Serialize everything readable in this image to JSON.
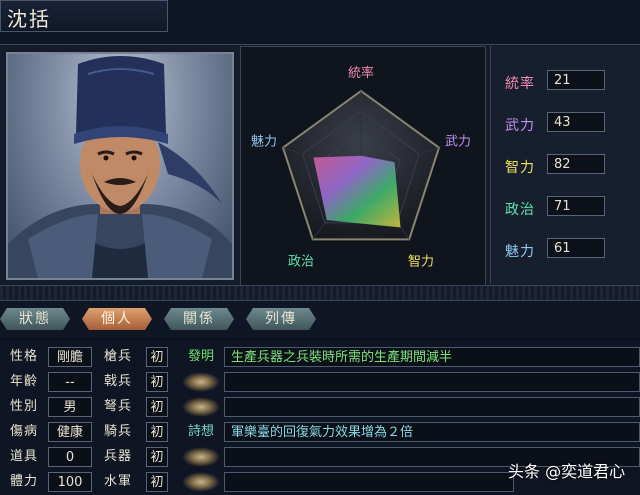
{
  "header": {
    "name": "沈括"
  },
  "colors": {
    "tong": "#f08ab0",
    "wu": "#c090f0",
    "zhi": "#f0e060",
    "zheng": "#60e0b0",
    "mei": "#90c8f0"
  },
  "radar": {
    "labels": {
      "tong": "統率",
      "wu": "武力",
      "zhi": "智力",
      "zheng": "政治",
      "mei": "魅力"
    },
    "max": 100
  },
  "stats": [
    {
      "key": "tong",
      "label": "統率",
      "value": "21"
    },
    {
      "key": "wu",
      "label": "武力",
      "value": "43"
    },
    {
      "key": "zhi",
      "label": "智力",
      "value": "82"
    },
    {
      "key": "zheng",
      "label": "政治",
      "value": "71"
    },
    {
      "key": "mei",
      "label": "魅力",
      "value": "61"
    }
  ],
  "tabs": [
    "狀態",
    "個人",
    "關係",
    "列傳"
  ],
  "personal": [
    {
      "label": "性格",
      "value": "剛膽"
    },
    {
      "label": "年齡",
      "value": "--"
    },
    {
      "label": "性別",
      "value": "男"
    },
    {
      "label": "傷病",
      "value": "健康"
    },
    {
      "label": "道具",
      "value": "0"
    },
    {
      "label": "體力",
      "value": "100"
    }
  ],
  "skills": [
    {
      "label": "槍兵",
      "rank": "初"
    },
    {
      "label": "戟兵",
      "rank": "初"
    },
    {
      "label": "弩兵",
      "rank": "初"
    },
    {
      "label": "騎兵",
      "rank": "初"
    },
    {
      "label": "兵器",
      "rank": "初"
    },
    {
      "label": "水軍",
      "rank": "初"
    }
  ],
  "traits": [
    {
      "tag": "發明",
      "desc": "生產兵器之兵裝時所需的生產期間減半",
      "style": "green"
    },
    {
      "tag": "",
      "desc": "",
      "style": "empty"
    },
    {
      "tag": "",
      "desc": "",
      "style": "empty"
    },
    {
      "tag": "詩想",
      "desc": "軍樂臺的回復氣力效果增為２倍",
      "style": "teal"
    },
    {
      "tag": "",
      "desc": "",
      "style": "empty"
    },
    {
      "tag": "",
      "desc": "",
      "style": "empty"
    }
  ],
  "watermark": "头条 @奕道君心"
}
